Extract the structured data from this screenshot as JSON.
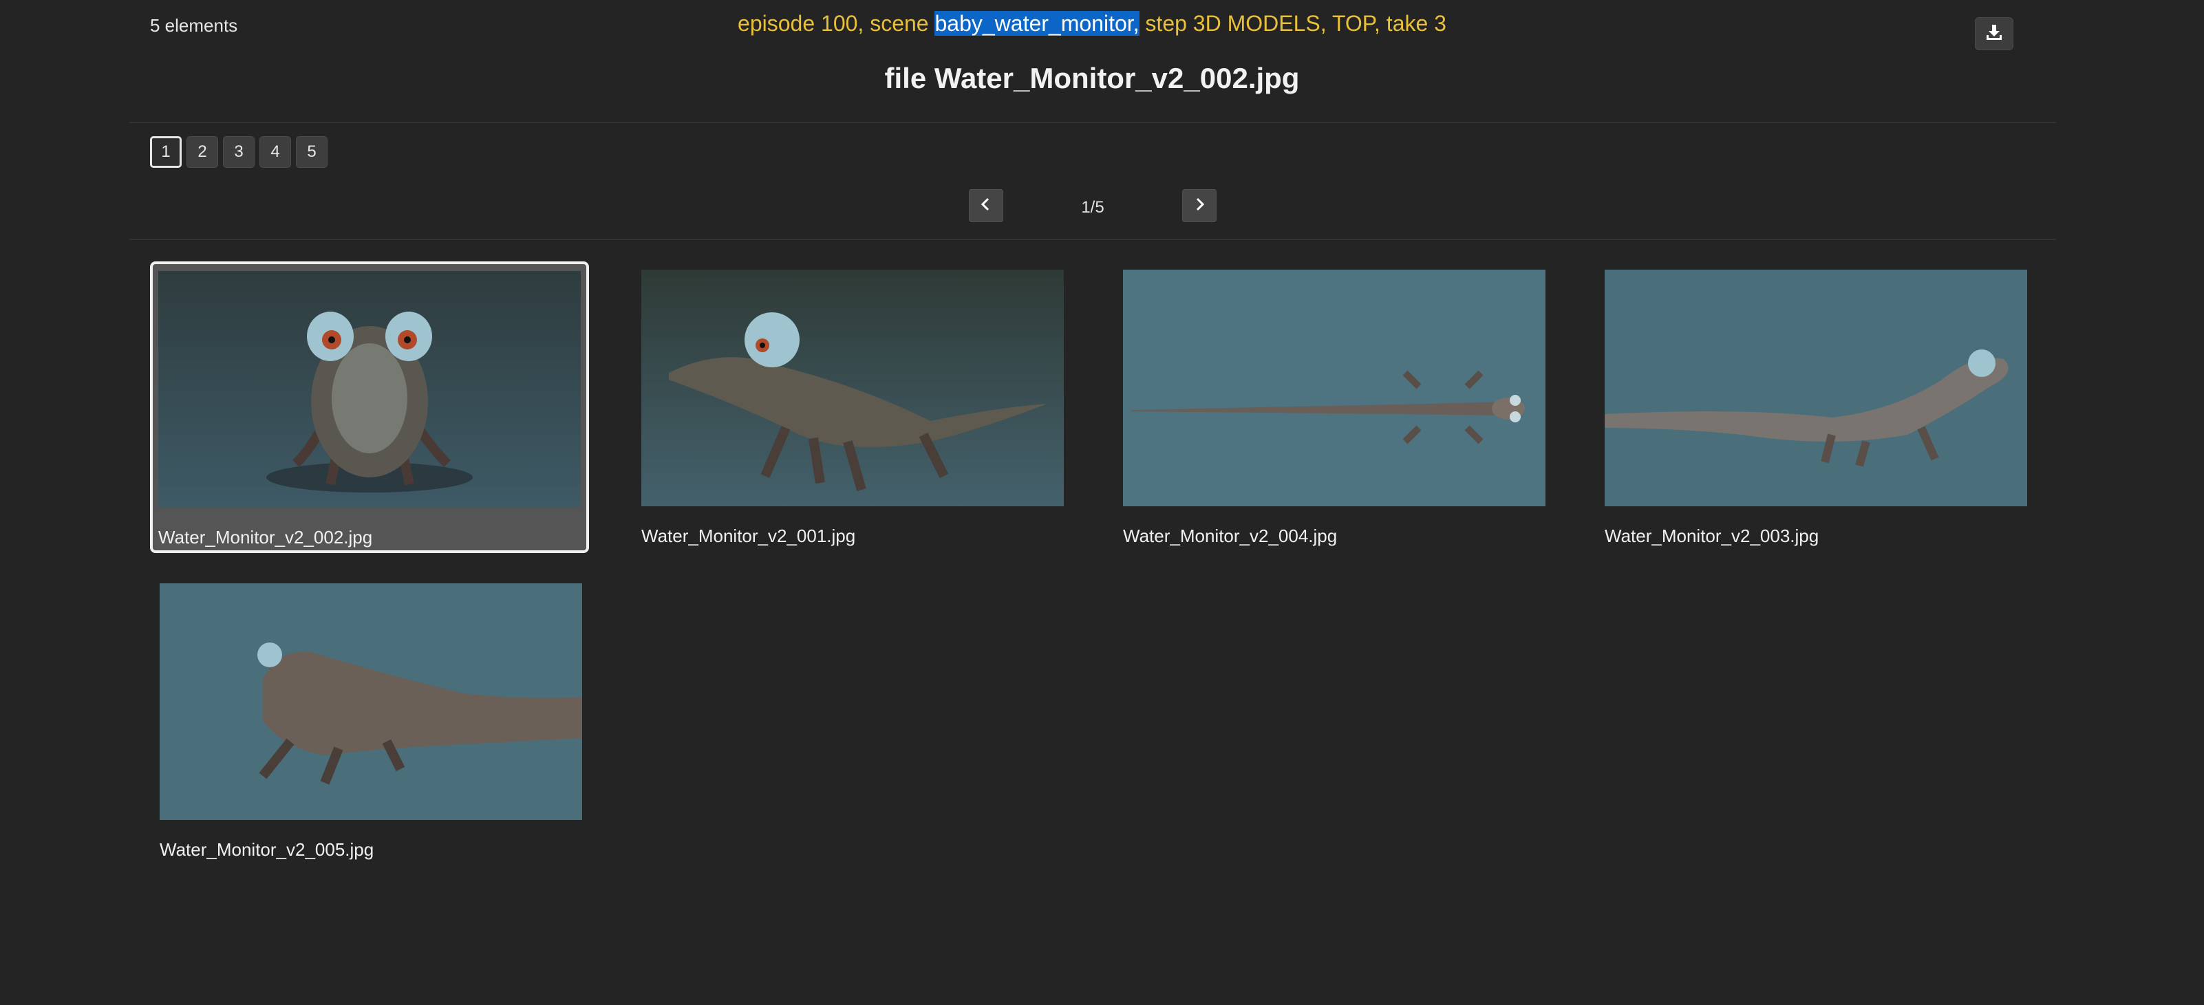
{
  "header": {
    "count_label": "5 elements",
    "crumb_before": "episode 100, scene ",
    "crumb_highlight": "baby_water_monitor,",
    "crumb_after": " step 3D MODELS, TOP, take 3",
    "file_title": "file Water_Monitor_v2_002.jpg",
    "download_icon": "download-icon"
  },
  "pagination": {
    "pages": [
      "1",
      "2",
      "3",
      "4",
      "5"
    ],
    "active_page": "1",
    "position": "1/5",
    "prev_icon": "chevron-left-icon",
    "next_icon": "chevron-right-icon"
  },
  "gallery": {
    "items": [
      {
        "filename": "Water_Monitor_v2_002.jpg",
        "view": "front",
        "selected": true
      },
      {
        "filename": "Water_Monitor_v2_001.jpg",
        "view": "three-quarter"
      },
      {
        "filename": "Water_Monitor_v2_004.jpg",
        "view": "top"
      },
      {
        "filename": "Water_Monitor_v2_003.jpg",
        "view": "side"
      },
      {
        "filename": "Water_Monitor_v2_005.jpg",
        "view": "rear-three-quarter"
      }
    ]
  },
  "colors": {
    "background": "#242424",
    "breadcrumb": "#e8c03a",
    "highlight": "#0b66c8",
    "thumb_bg": "#4a6e7a"
  }
}
